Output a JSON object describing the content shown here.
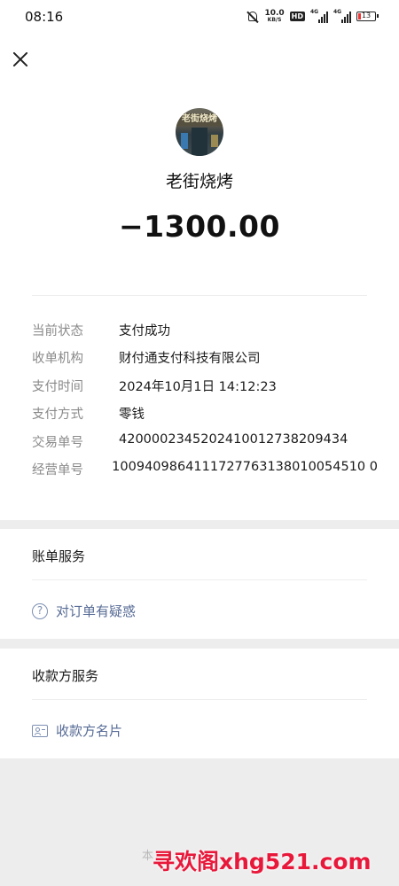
{
  "status_bar": {
    "time": "08:16",
    "net_speed_value": "10.0",
    "net_speed_unit": "KB/S",
    "hd_label": "HD",
    "signal_1_label": "4G",
    "signal_2_label": "4G",
    "battery_level": "13",
    "icons": [
      "mute-icon",
      "hd-icon",
      "signal-icon",
      "signal-icon",
      "battery-icon"
    ]
  },
  "header": {
    "close_icon": "close-icon"
  },
  "merchant": {
    "avatar_sign": "老街烧烤",
    "name": "老街烧烤",
    "amount": "−1300.00"
  },
  "details": [
    {
      "label": "当前状态",
      "value": "支付成功"
    },
    {
      "label": "收单机构",
      "value": "财付通支付科技有限公司"
    },
    {
      "label": "支付时间",
      "value": "2024年10月1日 14:12:23"
    },
    {
      "label": "支付方式",
      "value": "零钱"
    },
    {
      "label": "交易单号",
      "value": "4200002345202410012738209434"
    },
    {
      "label": "经营单号",
      "value": "1009409864111727763138010054510 0"
    }
  ],
  "bill_service": {
    "title": "账单服务",
    "link_label": "对订单有疑惑",
    "link_icon": "help-icon"
  },
  "payee_service": {
    "title": "收款方服务",
    "link_label": "收款方名片",
    "link_icon": "card-icon"
  },
  "footer": {
    "faint_text": "本",
    "watermark": "寻欢阁xhg521.com"
  },
  "colors": {
    "background": "#ededed",
    "card": "#ffffff",
    "link": "#576b95",
    "label_gray": "#8a8a8a",
    "watermark_red": "#e8183a"
  }
}
